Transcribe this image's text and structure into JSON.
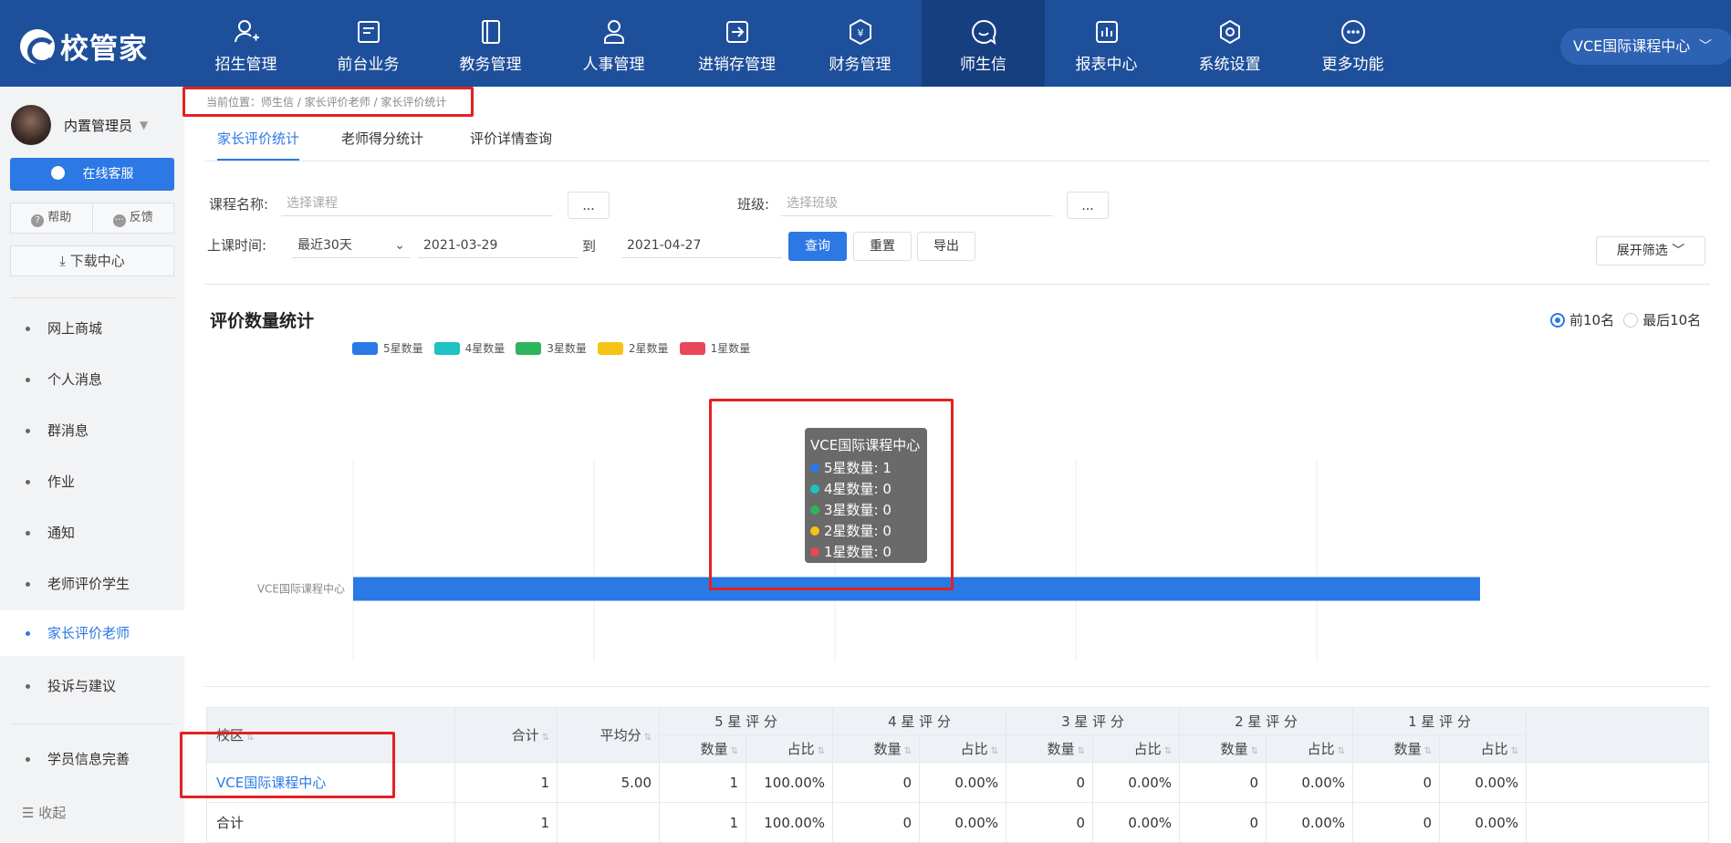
{
  "brand": {
    "name": "校管家"
  },
  "nav": {
    "items": [
      {
        "label": "招生管理",
        "icon": "person-add-icon"
      },
      {
        "label": "前台业务",
        "icon": "desk-icon"
      },
      {
        "label": "教务管理",
        "icon": "book-icon"
      },
      {
        "label": "人事管理",
        "icon": "person-icon"
      },
      {
        "label": "进销存管理",
        "icon": "inventory-icon"
      },
      {
        "label": "财务管理",
        "icon": "money-icon"
      },
      {
        "label": "师生信",
        "icon": "chat-icon",
        "active": true
      },
      {
        "label": "报表中心",
        "icon": "report-icon"
      },
      {
        "label": "系统设置",
        "icon": "settings-icon"
      },
      {
        "label": "更多功能",
        "icon": "more-icon"
      }
    ],
    "org": "VCE国际课程中心"
  },
  "sidebar": {
    "user": "内置管理员",
    "service": "在线客服",
    "help": "帮助",
    "feedback": "反馈",
    "download": "下载中心",
    "items": [
      {
        "label": "网上商城"
      },
      {
        "label": "个人消息"
      },
      {
        "label": "群消息"
      },
      {
        "label": "作业"
      },
      {
        "label": "通知"
      },
      {
        "label": "老师评价学生"
      },
      {
        "label": "家长评价老师",
        "active": true
      },
      {
        "label": "投诉与建议"
      },
      {
        "label": "学员信息完善"
      }
    ],
    "collapse": "收起"
  },
  "breadcrumb": "当前位置：师生信 / 家长评价老师 / 家长评价统计",
  "tabs": [
    "家长评价统计",
    "老师得分统计",
    "评价详情查询"
  ],
  "filters": {
    "course_label": "课程名称:",
    "course_placeholder": "选择课程",
    "class_label": "班级:",
    "class_placeholder": "选择班级",
    "ellipsis": "...",
    "time_label": "上课时间:",
    "time_range": "最近30天",
    "date_from": "2021-03-29",
    "to": "到",
    "date_to": "2021-04-27",
    "query": "查询",
    "reset": "重置",
    "export": "导出",
    "expand": "展开筛选"
  },
  "chart_section": {
    "title": "评价数量统计",
    "top10": "前10名",
    "bottom10": "最后10名"
  },
  "chart_data": {
    "type": "bar",
    "orientation": "horizontal",
    "stacked": true,
    "categories": [
      "VCE国际课程中心"
    ],
    "series": [
      {
        "name": "5星数量",
        "values": [
          1
        ],
        "color": "#2a79e4"
      },
      {
        "name": "4星数量",
        "values": [
          0
        ],
        "color": "#1fc1c1"
      },
      {
        "name": "3星数量",
        "values": [
          0
        ],
        "color": "#2db55d"
      },
      {
        "name": "2星数量",
        "values": [
          0
        ],
        "color": "#f6c316"
      },
      {
        "name": "1星数量",
        "values": [
          0
        ],
        "color": "#e8465a"
      }
    ],
    "xlim": [
      0,
      1
    ],
    "xticks": [
      "0",
      "0.2",
      "0.4",
      "0.6",
      "0.8",
      "1"
    ],
    "grid": true,
    "legend": "top-left"
  },
  "tooltip": {
    "title": "VCE国际课程中心",
    "rows": [
      "5星数量: 1",
      "4星数量: 0",
      "3星数量: 0",
      "2星数量: 0",
      "1星数量: 0"
    ]
  },
  "table": {
    "headers": {
      "campus": "校区",
      "total": "合计",
      "avg": "平均分",
      "groups": [
        "5 星 评 分",
        "4 星 评 分",
        "3 星 评 分",
        "2 星 评 分",
        "1 星 评 分"
      ],
      "count": "数量",
      "ratio": "占比"
    },
    "rows": [
      {
        "campus": "VCE国际课程中心",
        "total": "1",
        "avg": "5.00",
        "cells": [
          "1",
          "100.00%",
          "0",
          "0.00%",
          "0",
          "0.00%",
          "0",
          "0.00%",
          "0",
          "0.00%"
        ]
      },
      {
        "campus": "合计",
        "total": "1",
        "avg": "",
        "cells": [
          "1",
          "100.00%",
          "0",
          "0.00%",
          "0",
          "0.00%",
          "0",
          "0.00%",
          "0",
          "0.00%"
        ]
      }
    ]
  }
}
